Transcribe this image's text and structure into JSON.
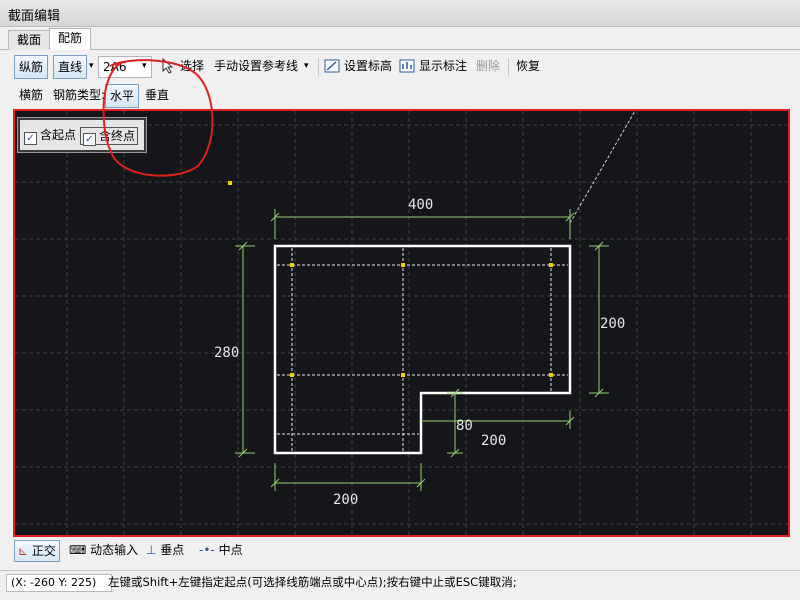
{
  "window": {
    "title": "截面编辑"
  },
  "tabs": [
    {
      "label": "截面"
    },
    {
      "label": "配筋"
    }
  ],
  "toolbar1": {
    "longitudinal": "纵筋",
    "line_mode": "直线",
    "rebar_spec": "2A6",
    "select": "选择",
    "manual_ref": "手动设置参考线",
    "set_elevation": "设置标高",
    "show_dims": "显示标注",
    "delete": "删除",
    "restore": "恢复"
  },
  "toolbar2": {
    "transverse": "横筋",
    "rebar_type_label": "钢筋类型:",
    "horizontal": "水平",
    "vertical": "垂直"
  },
  "options": {
    "include_start": {
      "label": "含起点",
      "checked": true
    },
    "include_end": {
      "label": "含终点",
      "checked": true
    }
  },
  "drawing": {
    "dims": {
      "top": "400",
      "right": "200",
      "left": "280",
      "bottom": "200",
      "step_h": "80",
      "step_w": "200"
    }
  },
  "snap": {
    "ortho": "正交",
    "dynamic_input": "动态输入",
    "perpendicular": "垂点",
    "midpoint": "中点"
  },
  "status": {
    "coord": "(X: -260 Y: 225)",
    "message": "左键或Shift+左键指定起点(可选择线筋端点或中心点);按右键中止或ESC键取消;"
  },
  "colors": {
    "canvas_bg": "#14161a",
    "dim": "#8fd36a",
    "rebar": "#ffcc00",
    "outline": "#ffffff",
    "canvas_border": "#e02020"
  }
}
